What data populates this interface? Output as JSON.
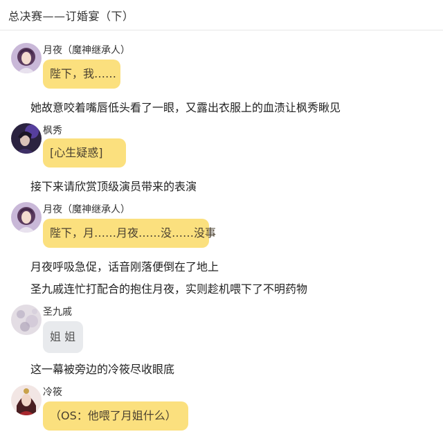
{
  "header": {
    "title": "总决赛——订婚宴（下）"
  },
  "messages": [
    {
      "type": "chat",
      "speaker": "月夜（魔神继承人）",
      "avatar": "yueye-avatar",
      "text": "陛下，我……",
      "bubble_color": "#fbe07e"
    },
    {
      "type": "narration",
      "text": "她故意咬着嘴唇低头看了一眼，又露出衣服上的血渍让枫秀瞅见"
    },
    {
      "type": "chat",
      "speaker": "枫秀",
      "avatar": "fengxiu-avatar",
      "text": "[心生疑惑]",
      "bubble_color": "#fbe07e"
    },
    {
      "type": "narration",
      "text": "接下来请欣赏顶级演员带来的表演"
    },
    {
      "type": "chat",
      "speaker": "月夜（魔神继承人）",
      "avatar": "yueye-avatar",
      "text": "陛下，月……月夜……没……没事",
      "bubble_color": "#fbe07e"
    },
    {
      "type": "narration",
      "text": "月夜呼吸急促，话音刚落便倒在了地上"
    },
    {
      "type": "narration",
      "text": "圣九戚连忙打配合的抱住月夜，实则趁机喂下了不明药物"
    },
    {
      "type": "chat",
      "speaker": "圣九戚",
      "avatar": "shengjiuqi-avatar",
      "text": "姐 姐",
      "bubble_color": "#e8eaed"
    },
    {
      "type": "narration",
      "text": "这一幕被旁边的冷筱尽收眼底"
    },
    {
      "type": "chat",
      "speaker": "冷筱",
      "avatar": "lengxiao-avatar",
      "text": "（OS：他喂了月姐什么）",
      "bubble_color": "#fbe07e"
    }
  ],
  "colors": {
    "bubble_yellow": "#fbe07e",
    "bubble_gray": "#e8eaed",
    "background": "#ffffff"
  }
}
